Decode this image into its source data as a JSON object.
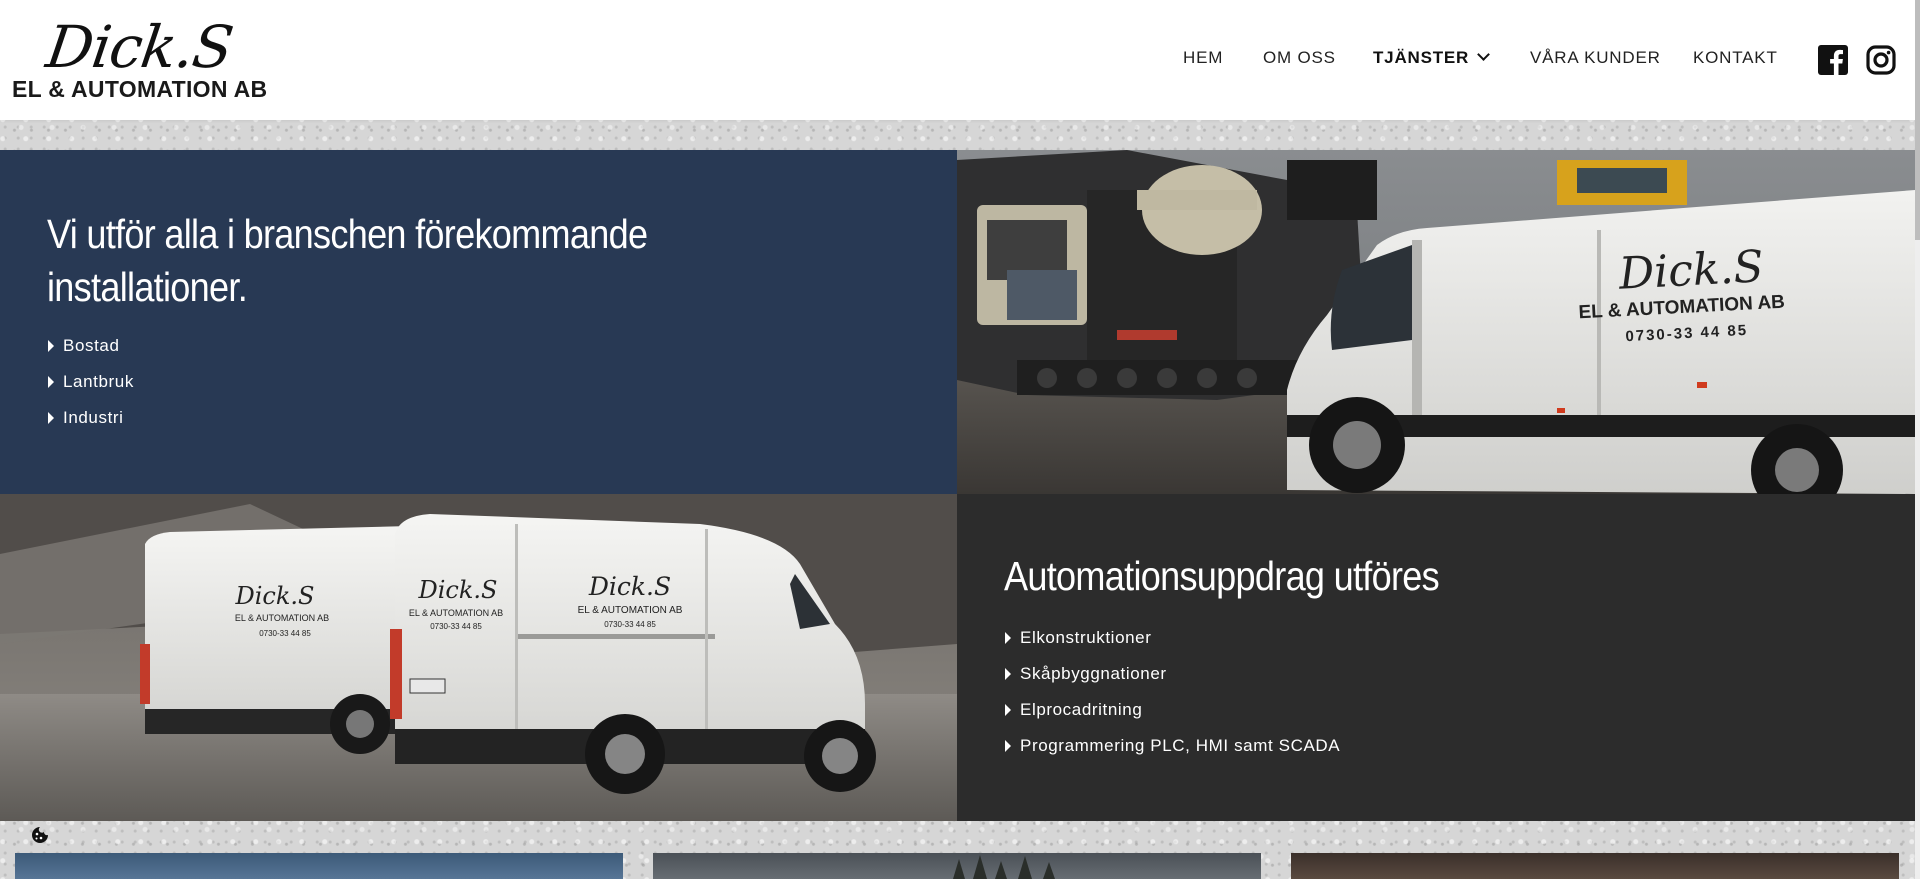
{
  "brand": {
    "script_name": "Dick.S",
    "subtitle": "EL & AUTOMATION AB"
  },
  "nav": {
    "items": [
      {
        "label": "HEM"
      },
      {
        "label": "OM OSS"
      },
      {
        "label": "TJÄNSTER"
      },
      {
        "label": "VÅRA KUNDER"
      },
      {
        "label": "KONTAKT"
      }
    ],
    "active_item": "TJÄNSTER",
    "social_icons": [
      "facebook-icon",
      "instagram-icon"
    ]
  },
  "section_installations": {
    "heading": "Vi utför alla i branschen förekommande installationer.",
    "items": [
      "Bostad",
      "Lantbruk",
      "Industri"
    ],
    "background_color": "#283954"
  },
  "section_automation": {
    "heading": "Automationsuppdrag utföres",
    "items": [
      "Elkonstruktioner",
      "Skåpbyggnationer",
      "Elprocadritning",
      "Programmering PLC, HMI samt SCADA"
    ],
    "background_color": "#2c2c2c"
  },
  "photo_van_right": {
    "van_logo": "Dick.S",
    "van_company": "EL & AUTOMATION AB",
    "van_phone": "0730-33 44 85"
  },
  "photo_vans_left": {
    "van_logo": "Dick.S",
    "van_company": "EL & AUTOMATION AB",
    "van_phone": "0730-33 44 85"
  },
  "cookie_icon": "cookie-icon"
}
